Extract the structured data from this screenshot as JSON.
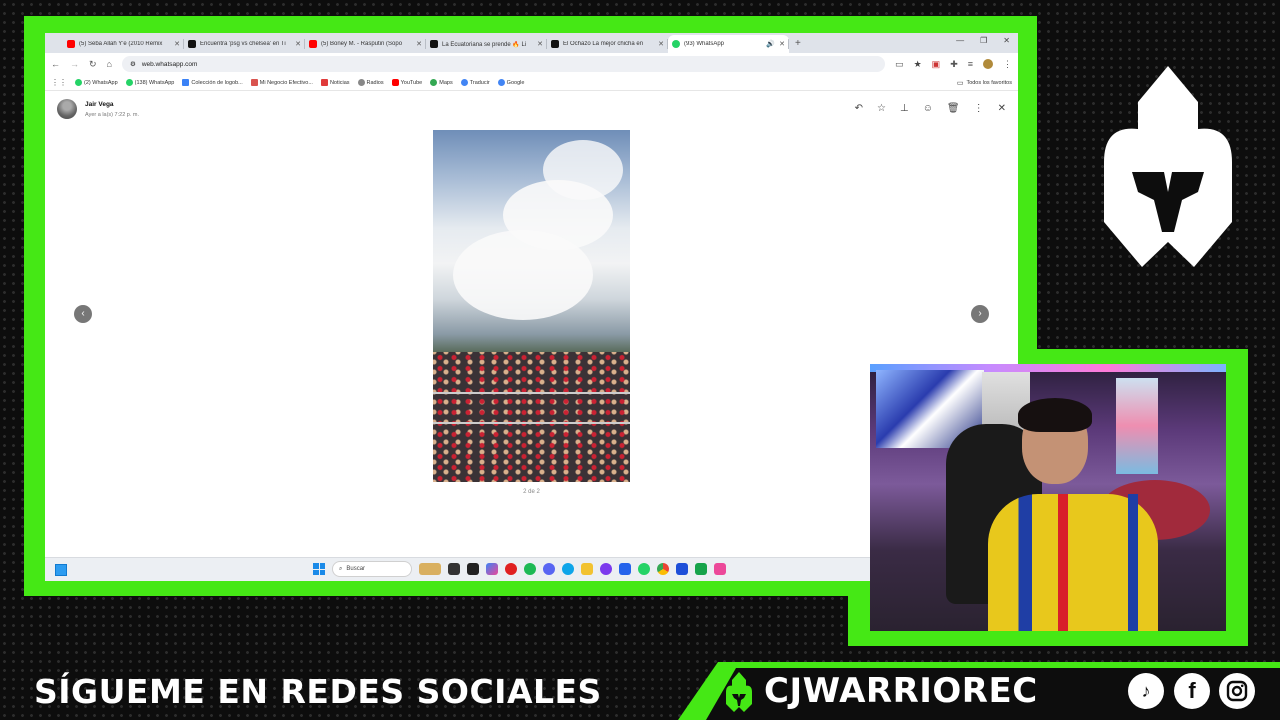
{
  "browser": {
    "tabs": [
      {
        "title": "(5) Seba Allah Y'e (2010 Remix",
        "favicon_color": "#ff0000",
        "active": false
      },
      {
        "title": "Encuentra 'psg vs chelsea' en Ti",
        "favicon_color": "#111111",
        "active": false
      },
      {
        "title": "(5) Boney M. - Rasputin (Sopo",
        "favicon_color": "#ff0000",
        "active": false
      },
      {
        "title": "La Ecuatoriana se prende 🔥 Li",
        "favicon_color": "#111111",
        "active": false
      },
      {
        "title": "El Ochazo La mejor chicha en",
        "favicon_color": "#111111",
        "active": false
      },
      {
        "title": "(93) WhatsApp",
        "favicon_color": "#25d366",
        "active": true
      }
    ],
    "url": "web.whatsapp.com",
    "bookmarks": [
      {
        "label": "(2) WhatsApp",
        "color": "#25d366"
      },
      {
        "label": "(138) WhatsApp",
        "color": "#25d366"
      },
      {
        "label": "Colección de logob...",
        "color": "#3b82f6"
      },
      {
        "label": "Mi Negocio Efectivo...",
        "color": "#d9534f"
      },
      {
        "label": "Noticias",
        "color": "#e03b3b"
      },
      {
        "label": "Radios",
        "color": "#888888"
      },
      {
        "label": "YouTube",
        "color": "#ff0000"
      },
      {
        "label": "Maps",
        "color": "#34a853"
      },
      {
        "label": "Traducir",
        "color": "#4285f4"
      },
      {
        "label": "Google",
        "color": "#4285f4"
      }
    ],
    "all_bookmarks": "Todos los favoritos"
  },
  "viewer": {
    "sender_name": "Jair Vega",
    "sender_time": "Ayer a la(s) 7:22 p. m.",
    "counter": "2 de 2"
  },
  "taskbar": {
    "search_placeholder": "Buscar"
  },
  "overlay": {
    "follow_text": "SÍGUEME EN REDES SOCIALES",
    "handle": "CJWARRIOREC",
    "accent_color": "#45e815",
    "social_icons": [
      "tiktok-icon",
      "facebook-icon",
      "instagram-icon"
    ]
  }
}
